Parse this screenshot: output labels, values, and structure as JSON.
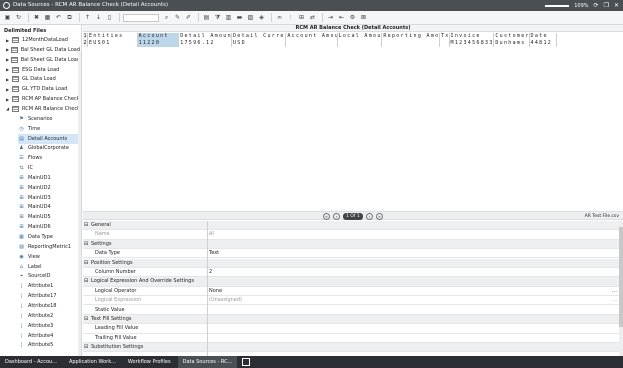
{
  "window": {
    "title": "Data Sources - RCM AR Balance Check (Detail Accounts)",
    "zoom": "109%"
  },
  "toolbar": {
    "icons": [
      "save-icon",
      "refresh-icon",
      "delete-icon",
      "grid-icon",
      "undo-icon",
      "copy-icon",
      "arrow-up-icon",
      "arrow-down-icon",
      "page-icon",
      "search-icon",
      "edit-icon",
      "pencil-icon",
      "table-icon",
      "filter-icon",
      "column-icon",
      "row-icon",
      "chart-icon",
      "tag-icon",
      "link-icon",
      "split-icon",
      "merge-icon",
      "transform-icon",
      "export-icon",
      "import-icon",
      "config-icon",
      "close-icon"
    ]
  },
  "sidebar": {
    "header": "Delimited Files",
    "items": [
      {
        "label": "12MonthDataLoad",
        "indent": 0,
        "expand": "collapsed",
        "icon": "grid"
      },
      {
        "label": "Bal Sheet GL Data Load",
        "indent": 0,
        "expand": "collapsed",
        "icon": "grid"
      },
      {
        "label": "Bal Sheet GL Data Load",
        "indent": 0,
        "expand": "collapsed",
        "icon": "grid"
      },
      {
        "label": "ESG Data Load",
        "indent": 0,
        "expand": "collapsed",
        "icon": "grid"
      },
      {
        "label": "GL Data Load",
        "indent": 0,
        "expand": "collapsed",
        "icon": "grid"
      },
      {
        "label": "GL YTD Data Load",
        "indent": 0,
        "expand": "collapsed",
        "icon": "grid"
      },
      {
        "label": "RCM AP Balance Check",
        "indent": 0,
        "expand": "collapsed",
        "icon": "grid"
      },
      {
        "label": "RCM AR Balance Check",
        "indent": 0,
        "expand": "expanded",
        "icon": "grid"
      },
      {
        "label": "Scenarios",
        "indent": 1,
        "expand": "",
        "icon": "scenario"
      },
      {
        "label": "Time",
        "indent": 1,
        "expand": "",
        "icon": "clock"
      },
      {
        "label": "Detail Accounts",
        "indent": 1,
        "expand": "",
        "icon": "accounts",
        "selected": true
      },
      {
        "label": "GlobalCorporate",
        "indent": 1,
        "expand": "",
        "icon": "entity"
      },
      {
        "label": "Flows",
        "indent": 1,
        "expand": "",
        "icon": "flow"
      },
      {
        "label": "IC",
        "indent": 1,
        "expand": "",
        "icon": "ic"
      },
      {
        "label": "MainUD1",
        "indent": 1,
        "expand": "",
        "icon": "ud"
      },
      {
        "label": "MainUD2",
        "indent": 1,
        "expand": "",
        "icon": "ud"
      },
      {
        "label": "MainUD3",
        "indent": 1,
        "expand": "",
        "icon": "ud"
      },
      {
        "label": "MainUD4",
        "indent": 1,
        "expand": "",
        "icon": "ud"
      },
      {
        "label": "MainUD5",
        "indent": 1,
        "expand": "",
        "icon": "ud"
      },
      {
        "label": "MainUD6",
        "indent": 1,
        "expand": "",
        "icon": "ud"
      },
      {
        "label": "Data Type",
        "indent": 1,
        "expand": "",
        "icon": "datatype"
      },
      {
        "label": "ReportingMetric1",
        "indent": 1,
        "expand": "",
        "icon": "metric"
      },
      {
        "label": "View",
        "indent": 1,
        "expand": "",
        "icon": "view"
      },
      {
        "label": "Label",
        "indent": 1,
        "expand": "",
        "icon": "label"
      },
      {
        "label": "SourceID",
        "indent": 1,
        "expand": "",
        "icon": "source"
      },
      {
        "label": "Attribute1",
        "indent": 1,
        "expand": "",
        "icon": "attr"
      },
      {
        "label": "Attribute17",
        "indent": 1,
        "expand": "",
        "icon": "attr"
      },
      {
        "label": "Attribute18",
        "indent": 1,
        "expand": "",
        "icon": "attr"
      },
      {
        "label": "Attribute2",
        "indent": 1,
        "expand": "",
        "icon": "attr"
      },
      {
        "label": "Attribute3",
        "indent": 1,
        "expand": "",
        "icon": "attr"
      },
      {
        "label": "Attribute4",
        "indent": 1,
        "expand": "",
        "icon": "attr"
      },
      {
        "label": "Attribute5",
        "indent": 1,
        "expand": "",
        "icon": "attr"
      }
    ]
  },
  "grid": {
    "title": "RCM AR Balance Check (Detail Accounts)",
    "header_row_num": "1",
    "data_row_num": "2",
    "columns": [
      {
        "header": "Entities",
        "value": "EUS01"
      },
      {
        "header": "Account",
        "value": "11220",
        "hl": true
      },
      {
        "header": "Detail Amount",
        "value": "17596.12"
      },
      {
        "header": "Detail Currency",
        "value": "USD"
      },
      {
        "header": "Account Amount",
        "value": ""
      },
      {
        "header": "Local Amount",
        "value": ""
      },
      {
        "header": "Reporting Amount",
        "value": ""
      },
      {
        "header": "Tx",
        "value": ""
      },
      {
        "header": "Invoice",
        "value": "M123456833"
      },
      {
        "header": "Customer",
        "value": "Dunhams"
      },
      {
        "header": "Date",
        "value": "44812"
      }
    ]
  },
  "paginator": {
    "page_label": "1 Of 1",
    "file_name": "AR Test File.csv"
  },
  "properties": [
    {
      "type": "cat",
      "name": "General"
    },
    {
      "type": "prop",
      "name": "Name",
      "value": "AI",
      "disabled": true
    },
    {
      "type": "cat",
      "name": "Settings"
    },
    {
      "type": "prop",
      "name": "Data Type",
      "value": "Text"
    },
    {
      "type": "cat",
      "name": "Position Settings"
    },
    {
      "type": "prop",
      "name": "Column Number",
      "value": "2"
    },
    {
      "type": "cat",
      "name": "Logical Expression And Override Settings"
    },
    {
      "type": "prop",
      "name": "Logical Operator",
      "value": "None",
      "dropdown": true
    },
    {
      "type": "prop",
      "name": "Logical Expression",
      "value": "(Unassigned)",
      "disabled": true,
      "dropdown": true
    },
    {
      "type": "prop",
      "name": "Static Value",
      "value": ""
    },
    {
      "type": "cat",
      "name": "Text Fill Settings"
    },
    {
      "type": "prop",
      "name": "Leading Fill Value",
      "value": ""
    },
    {
      "type": "prop",
      "name": "Trailing Fill Value",
      "value": ""
    },
    {
      "type": "cat",
      "name": "Substitution Settings"
    }
  ],
  "taskbar": {
    "tabs": [
      {
        "label": "Dashboard - Accou..."
      },
      {
        "label": "Application Work..."
      },
      {
        "label": "Workflow Profiles"
      },
      {
        "label": "Data Sources - RC...",
        "active": true
      }
    ]
  }
}
